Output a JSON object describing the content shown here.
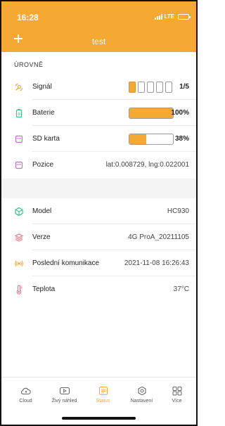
{
  "status_bar": {
    "time": "16:28",
    "network": "LTE"
  },
  "header": {
    "title": "test",
    "add_label": "+"
  },
  "section": {
    "title": "ÚROVNĚ"
  },
  "levels": [
    {
      "label": "Signál",
      "value": "1/5",
      "level": 0.2,
      "segments": 5,
      "segments_on": 1
    },
    {
      "label": "Baterie",
      "value": "100%",
      "level": 1.0
    },
    {
      "label": "SD karta",
      "value": "38%",
      "level": 0.38
    },
    {
      "label": "Pozice",
      "value": "lat:0.008729, lng:0.022001"
    }
  ],
  "info": [
    {
      "label": "Model",
      "value": "HC930"
    },
    {
      "label": "Verze",
      "value": "4G ProA_20211105"
    },
    {
      "label": "Poslední komunikace",
      "value": "2021-11-08 16:26:43"
    },
    {
      "label": "Teplota",
      "value": "37°C"
    }
  ],
  "tabs": [
    {
      "label": "Cloud",
      "icon": "cloud-icon"
    },
    {
      "label": "Živý náhled",
      "icon": "live-view-icon"
    },
    {
      "label": "Status",
      "icon": "status-icon",
      "active": true
    },
    {
      "label": "Nastavení",
      "icon": "settings-icon"
    },
    {
      "label": "Více",
      "icon": "more-icon"
    }
  ],
  "colors": {
    "accent": "#f5a832",
    "signal_icon": "#f5a832",
    "battery_icon": "#3cc08a",
    "storage_icon": "#c86cd0",
    "position_icon": "#c86cd0",
    "model_icon": "#3cc08a",
    "version_icon": "#e8707a",
    "communication_icon": "#f5a832",
    "temperature_icon": "#e8707a"
  }
}
